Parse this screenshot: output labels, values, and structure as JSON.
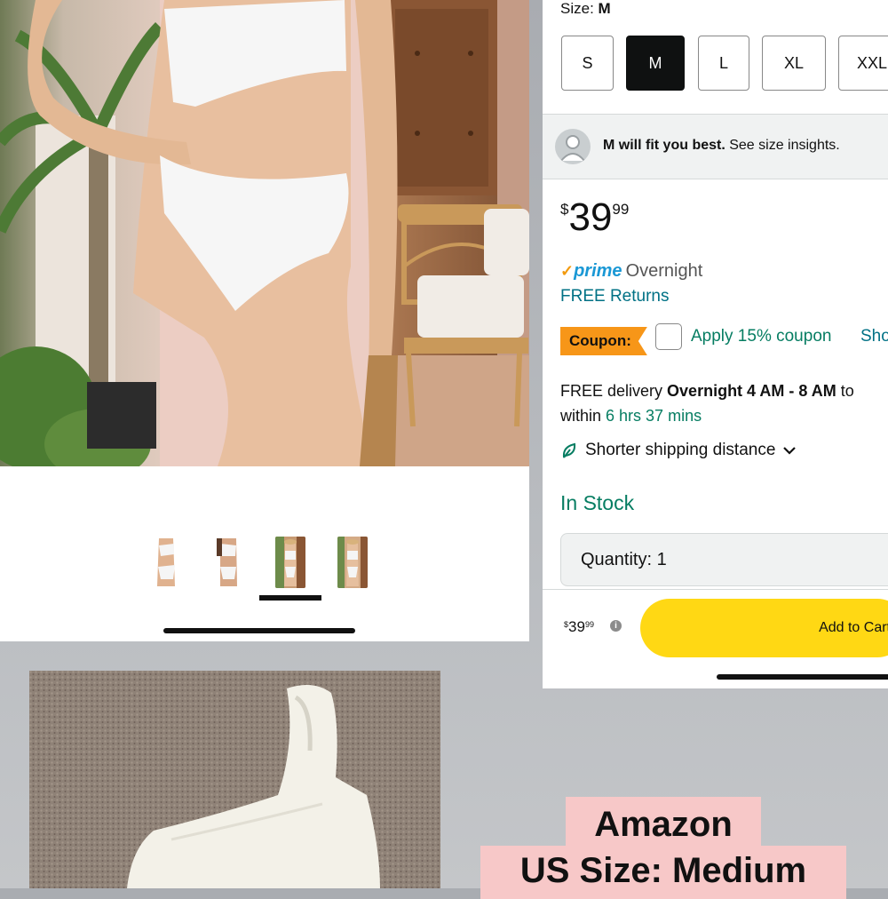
{
  "gallery": {
    "thumbnail_count": 4,
    "selected_thumbnail_index": 2
  },
  "details": {
    "size_label": "Size:",
    "size_value": "M",
    "sizes": [
      "S",
      "M",
      "L",
      "XL",
      "XXL"
    ],
    "selected_size": "M",
    "fit_bold": "M will fit you best.",
    "fit_link": "See size insights.",
    "price_symbol": "$",
    "price_whole": "39",
    "price_fraction": "99",
    "prime_check": "✓",
    "prime_word": "prime",
    "prime_speed": "Overnight",
    "free_returns": "FREE Returns",
    "coupon_badge": "Coupon:",
    "coupon_text": "Apply 15% coupon",
    "coupon_shop": "Sho",
    "delivery_prefix": "FREE delivery ",
    "delivery_bold": "Overnight 4 AM - 8 AM",
    "delivery_suffix": " to",
    "delivery_within": "within ",
    "delivery_time": "6 hrs 37 mins",
    "shipping_distance": "Shorter shipping distance",
    "stock_status": "In Stock",
    "quantity_label": "Quantity:",
    "quantity_value": "1",
    "bar_price_symbol": "$",
    "bar_price_whole": "39",
    "bar_price_fraction": "99",
    "info_icon": "i",
    "add_to_cart": "Add to Cart"
  },
  "captions": {
    "line1": "Amazon",
    "line2": "US Size: Medium"
  },
  "colors": {
    "prime_blue": "#1a98d5",
    "link_teal": "#007185",
    "stock_green": "#067d62",
    "coupon_orange": "#f79618",
    "cart_yellow": "#ffd814",
    "caption_pink": "#f7c8c8"
  }
}
